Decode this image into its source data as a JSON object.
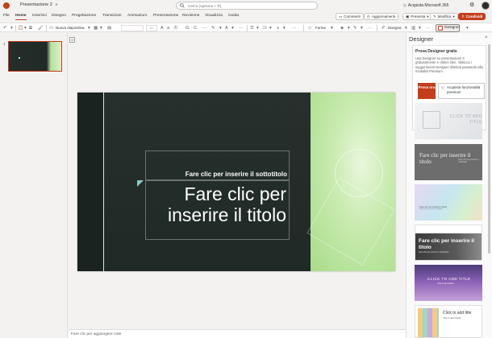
{
  "titlebar": {
    "doc_title": "Presentazione 2",
    "chevron": "∨",
    "search_placeholder": "Cerca (opzione + R)",
    "buy_label": "Acquista Microsoft 365",
    "icons": {
      "app": "powerpoint-logo",
      "search": "search-icon",
      "settings": "gear-icon",
      "avatar": "avatar"
    }
  },
  "menu": {
    "tabs": [
      "File",
      "Home",
      "Inserisci",
      "Disegno",
      "Progettazione",
      "Transizioni",
      "Animazioni",
      "Presentazione",
      "Revisione",
      "Visualizza",
      "Guida"
    ],
    "active_tab": "Home",
    "right_buttons": {
      "comments": "Commenti",
      "catchup": "Aggiornamenti",
      "present": "Presenta",
      "edit": "Modifica",
      "share": "Condividi"
    }
  },
  "toolbar": {
    "new_slide": "Nuova diapositiva",
    "font_size": "12",
    "shapes": "Forme",
    "draw": "Disegna",
    "designer": "Designer",
    "more": "···"
  },
  "slide": {
    "number": "1",
    "subtitle_placeholder": "Fare clic per inserire il sottotitolo",
    "title_placeholder": "Fare clic per inserire il titolo"
  },
  "notes_placeholder": "Fare clic per aggiungere note",
  "designer": {
    "title": "Designer",
    "close": "×",
    "promo": {
      "heading": "Prova Designer gratis",
      "body": "Usa Designer su presentazioni 3 gratuitamente e ottieni idee. Sblocca i suggerimenti Designer illimitati passando alla modalità Premium",
      "try_button": "Prova ora",
      "buy_button": "Acquista funzionalità premium"
    },
    "suggestions": [
      {
        "title": "CLICK TO ADD TITLE",
        "subtitle": ""
      },
      {
        "title": "Fare clic per inserire il titolo",
        "subtitle": "Fare clic per inserire il sottotitolo"
      },
      {
        "title": "Fare clic per inserire il titolo",
        "subtitle": "Fare clic per inserire il sottotitolo"
      },
      {
        "title": "Fare clic per inserire il titolo",
        "subtitle": "Fare clic per inserire il sottotitolo"
      },
      {
        "title": "CLICK TO ADD TITLE",
        "subtitle": "Click to add subtitle"
      },
      {
        "title": "Click to add title",
        "subtitle": "Click to add subtitle"
      }
    ]
  },
  "colors": {
    "accent": "#c43e1c",
    "slide_dark": "#1f2925",
    "slide_green": "#a9dc8a"
  }
}
